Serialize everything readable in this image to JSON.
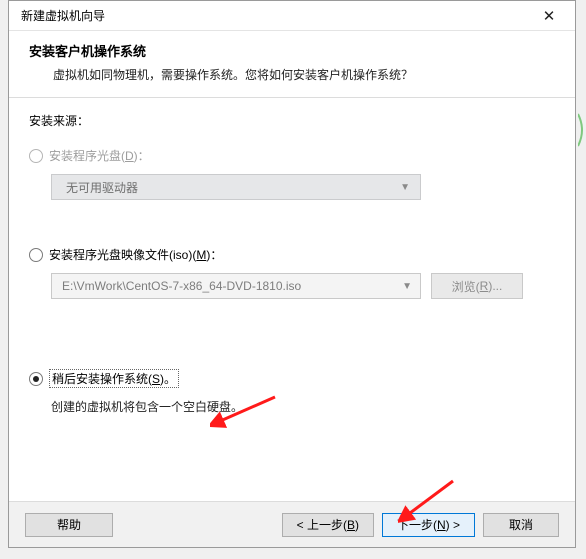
{
  "titlebar": {
    "text": "新建虚拟机向导"
  },
  "header": {
    "title": "安装客户机操作系统",
    "subtitle": "虚拟机如同物理机，需要操作系统。您将如何安装客户机操作系统？"
  },
  "body": {
    "source_label": "安装来源：",
    "opt1": {
      "label_pre": "安装程序光盘(",
      "mn": "D",
      "label_post": ")：",
      "dropdown": "无可用驱动器"
    },
    "opt2": {
      "label_pre": "安装程序光盘映像文件(iso)(",
      "mn": "M",
      "label_post": ")：",
      "path": "E:\\VmWork\\CentOS-7-x86_64-DVD-1810.iso",
      "browse_pre": "浏览(",
      "browse_mn": "R",
      "browse_post": ")..."
    },
    "opt3": {
      "label_pre": "稍后安装操作系统(",
      "mn": "S",
      "label_post": ")。",
      "hint": "创建的虚拟机将包含一个空白硬盘。"
    }
  },
  "footer": {
    "help": "帮助",
    "back_pre": "< 上一步(",
    "back_mn": "B",
    "back_post": ")",
    "next_pre": "下一步(",
    "next_mn": "N",
    "next_post": ") >",
    "cancel": "取消"
  }
}
